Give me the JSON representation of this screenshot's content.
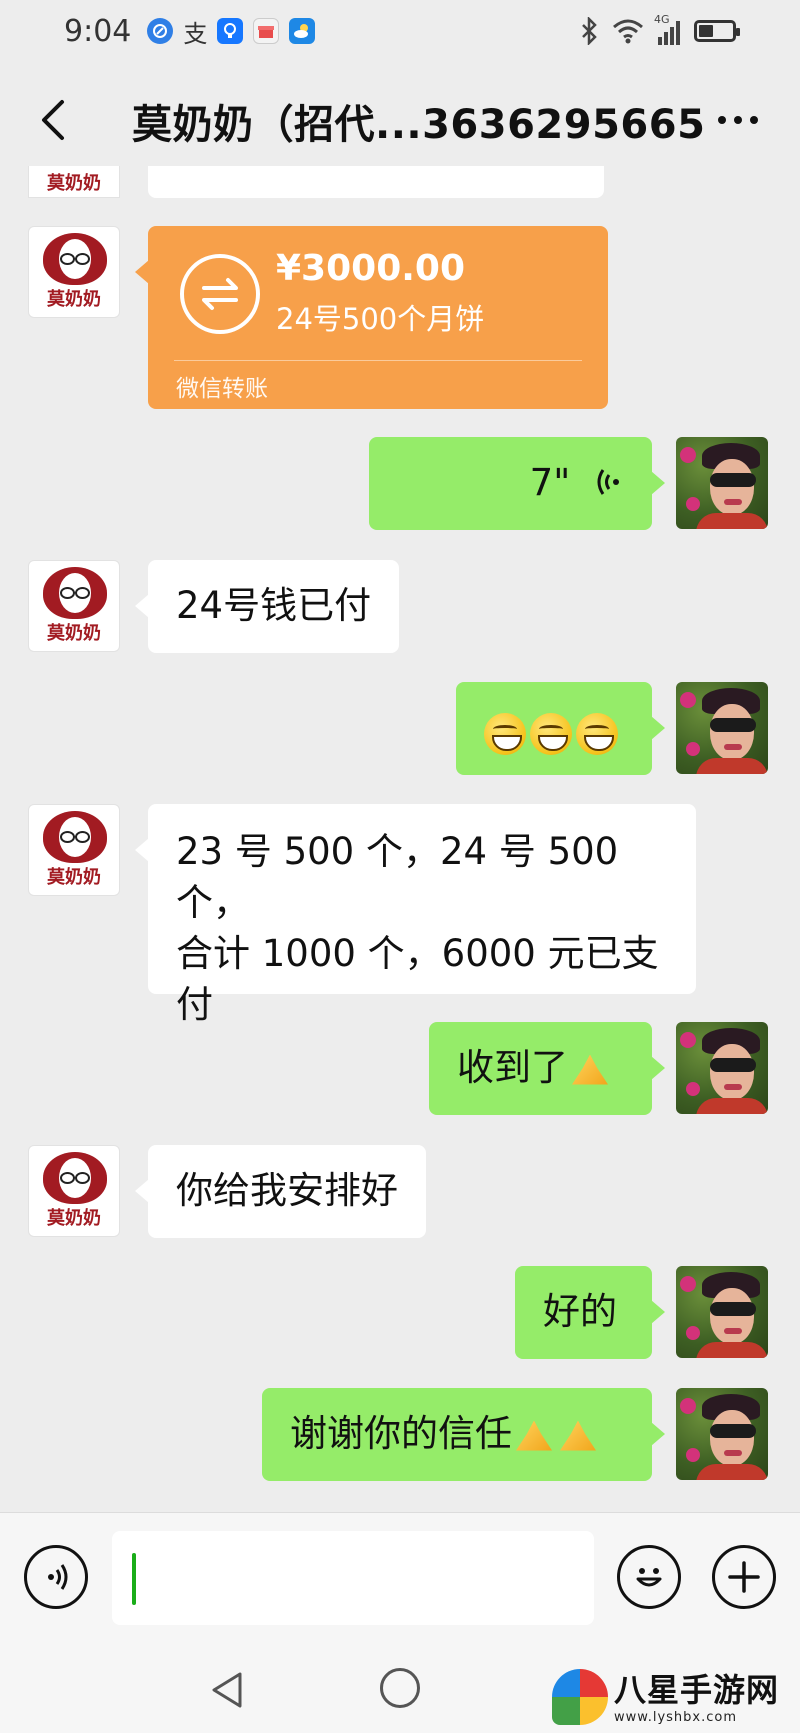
{
  "status_bar": {
    "time": "9:04",
    "alipay_char": "支",
    "network": "4G",
    "icons": [
      "browser-icon",
      "alipay-icon",
      "bulb-app-icon",
      "gift-box-icon",
      "weather-icon",
      "bluetooth-icon",
      "wifi-icon",
      "signal-icon",
      "battery-icon"
    ]
  },
  "header": {
    "title": "莫奶奶（招代...3636295665"
  },
  "brand_avatar_text": "莫奶奶",
  "transfer": {
    "amount": "¥3000.00",
    "note": "24号500个月饼",
    "label": "微信转账",
    "color": "#f7a04a"
  },
  "voice_message": {
    "duration": "7\""
  },
  "messages": {
    "m1": "24号钱已付",
    "m3_lines": [
      "23 号 500 个，24 号 500 个，",
      "合计 1000 个，6000 元已支",
      "付"
    ],
    "m4": "收到了",
    "m5": "你给我安排好",
    "m6": "好的",
    "m7": "谢谢你的信任"
  },
  "colors": {
    "background": "#ededed",
    "outgoing_bubble": "#95ec69",
    "incoming_bubble": "#ffffff",
    "caret": "#1aad19"
  },
  "watermark": {
    "title": "八星手游网",
    "url": "www.lyshbx.com"
  }
}
